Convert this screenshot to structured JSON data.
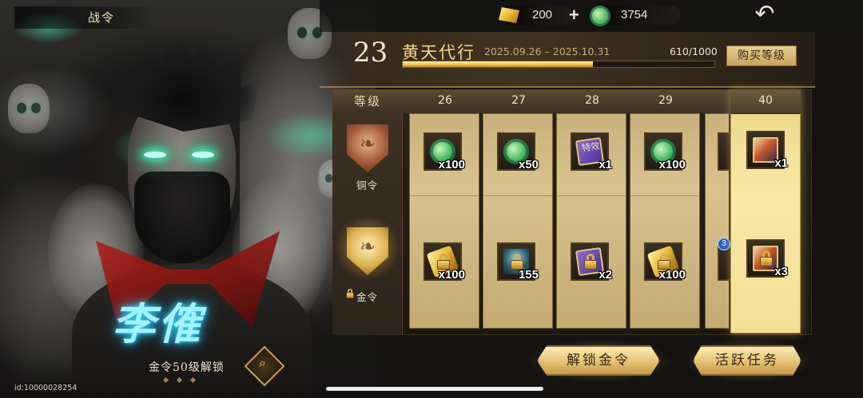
{
  "header": {
    "tab_title": "战令",
    "gold_amount": "200",
    "jade_amount": "3754",
    "plus_label": "+",
    "back_icon": "back-arrow-icon"
  },
  "season": {
    "level": "23",
    "name": "黄天代行",
    "dates": "2025.09.26 – 2025.10.31",
    "xp": "610/1000",
    "xp_progress": 0.61,
    "buy_label": "购买等级"
  },
  "hero": {
    "name": "李傕",
    "unlock_tip": "金令50级解锁",
    "user_id": "id:10000028254"
  },
  "table": {
    "header_label": "等级",
    "copper_label": "铜令",
    "gold_label": "金令",
    "card_text": "特效",
    "levels": [
      {
        "level": "26",
        "copper": {
          "icon": "jade-coin-icon",
          "qty": "x100"
        },
        "gold": {
          "icon": "gold-ingot-icon",
          "qty": "x100"
        }
      },
      {
        "level": "27",
        "copper": {
          "icon": "jade-coin-icon",
          "qty": "x50"
        },
        "gold": {
          "icon": "scene-icon",
          "qty": "155"
        }
      },
      {
        "level": "28",
        "copper": {
          "icon": "effect-card-icon",
          "qty": "x1"
        },
        "gold": {
          "icon": "effect-card-icon",
          "qty": "x2"
        }
      },
      {
        "level": "29",
        "copper": {
          "icon": "jade-coin-icon",
          "qty": "x100"
        },
        "gold": {
          "icon": "gold-ingot-icon",
          "qty": "x100"
        }
      }
    ],
    "partial_badge": "3",
    "milestone": {
      "level": "40",
      "copper": {
        "icon": "hero-card-icon",
        "qty": "x1"
      },
      "gold": {
        "icon": "hero-card-icon",
        "qty": "x3"
      }
    }
  },
  "buttons": {
    "unlock_gold": "解锁金令",
    "active_tasks": "活跃任务"
  },
  "colors": {
    "accent_gold": "#e8c57a",
    "jade_green": "#55c06a",
    "hero_name_glow": "#3fd6ff"
  }
}
